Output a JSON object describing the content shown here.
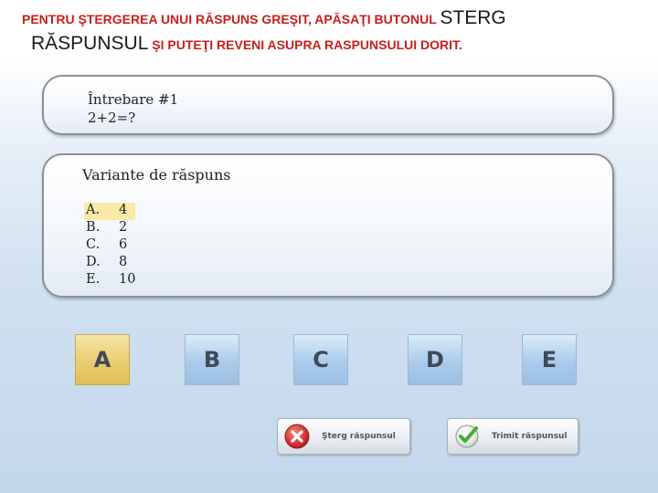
{
  "instructions": {
    "line1_red": "PENTRU  ŞTERGEREA UNUI RĂSPUNS GREŞIT,  APĂSAŢI BUTONUL",
    "line1_black": "STERG",
    "line2_black": "RĂSPUNSUL",
    "line2_red": "ŞI  PUTEŢI  REVENI  ASUPRA  RASPUNSULUI  DORIT."
  },
  "question": {
    "title": "Întrebare #1",
    "text": "2+2=?"
  },
  "options": {
    "title": "Variante de răspuns",
    "selected": "A",
    "items": [
      {
        "letter": "A.",
        "value": "4"
      },
      {
        "letter": "B.",
        "value": "2"
      },
      {
        "letter": "C.",
        "value": "6"
      },
      {
        "letter": "D.",
        "value": "8"
      },
      {
        "letter": "E.",
        "value": "10"
      }
    ]
  },
  "answer_buttons": [
    "A",
    "B",
    "C",
    "D",
    "E"
  ],
  "actions": {
    "delete_label": "Şterg răspunsul",
    "submit_label": "Trimit răspunsul"
  },
  "colors": {
    "instruction_red": "#c8201a",
    "selected_highlight": "#fbeaa7",
    "button_blue": "#aacbea",
    "button_selected": "#e9cd6f",
    "delete_icon": "#d83a3a",
    "submit_icon": "#49a83a"
  }
}
